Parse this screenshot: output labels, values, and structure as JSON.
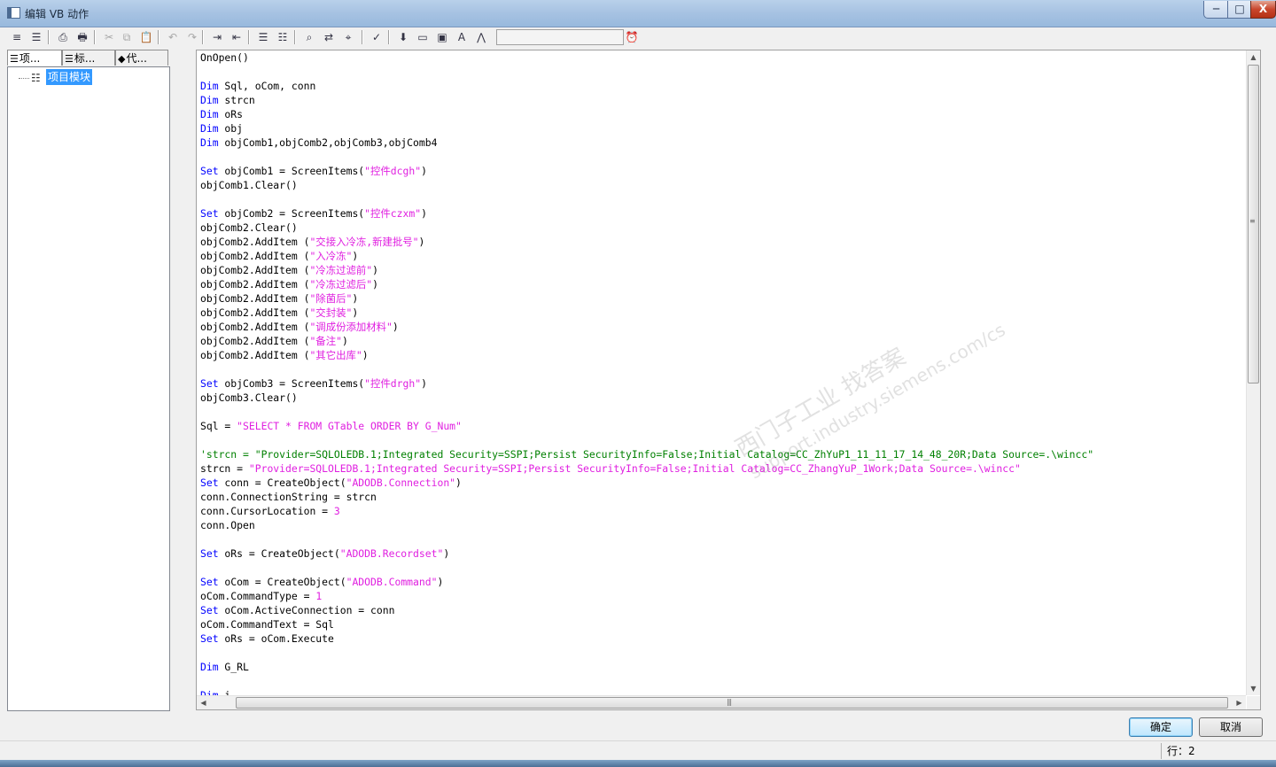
{
  "window": {
    "title": "编辑 VB 动作",
    "min_label": "─",
    "max_label": "□",
    "close_label": "X"
  },
  "toolbar": {
    "buttons": [
      {
        "name": "align-left-icon",
        "glyph": "≡"
      },
      {
        "name": "format-icon",
        "glyph": "☰"
      },
      {
        "name": "print-icon",
        "glyph": "⎙"
      },
      {
        "name": "print-preview-icon",
        "glyph": "🖶"
      },
      {
        "name": "cut-icon",
        "glyph": "✂"
      },
      {
        "name": "copy-icon",
        "glyph": "⧉"
      },
      {
        "name": "paste-icon",
        "glyph": "📋"
      },
      {
        "name": "undo-icon",
        "glyph": "↶"
      },
      {
        "name": "redo-icon",
        "glyph": "↷"
      },
      {
        "name": "indent-icon",
        "glyph": "⇥"
      },
      {
        "name": "outdent-icon",
        "glyph": "⇤"
      },
      {
        "name": "comment-icon",
        "glyph": "☰"
      },
      {
        "name": "uncomment-icon",
        "glyph": "☷"
      },
      {
        "name": "find-icon",
        "glyph": "⌕"
      },
      {
        "name": "replace-icon",
        "glyph": "⇄"
      },
      {
        "name": "goto-icon",
        "glyph": "⌖"
      },
      {
        "name": "syntax-check-icon",
        "glyph": "✓"
      },
      {
        "name": "import-icon",
        "glyph": "⬇"
      },
      {
        "name": "folder-icon",
        "glyph": "▭"
      },
      {
        "name": "new-folder-icon",
        "glyph": "▣"
      },
      {
        "name": "tag-icon",
        "glyph": "A"
      },
      {
        "name": "compass-icon",
        "glyph": "⋀"
      },
      {
        "name": "alarm-clock-icon",
        "glyph": "⏰"
      }
    ]
  },
  "left_panel": {
    "tabs": [
      {
        "label": "项...",
        "icon": "☰"
      },
      {
        "label": "标...",
        "icon": "☰"
      },
      {
        "label": "代...",
        "icon": "◆"
      }
    ],
    "tree_item": "项目模块"
  },
  "code_lines": [
    [
      {
        "t": "OnOpen()"
      }
    ],
    [],
    [
      {
        "t": "Dim",
        "c": "kw"
      },
      {
        "t": " Sql, oCom, conn"
      }
    ],
    [
      {
        "t": "Dim",
        "c": "kw"
      },
      {
        "t": " strcn"
      }
    ],
    [
      {
        "t": "Dim",
        "c": "kw"
      },
      {
        "t": " oRs"
      }
    ],
    [
      {
        "t": "Dim",
        "c": "kw"
      },
      {
        "t": " obj"
      }
    ],
    [
      {
        "t": "Dim",
        "c": "kw"
      },
      {
        "t": " objComb1,objComb2,objComb3,objComb4"
      }
    ],
    [],
    [
      {
        "t": "Set",
        "c": "kw"
      },
      {
        "t": " objComb1 = ScreenItems("
      },
      {
        "t": "\"控件dcgh\"",
        "c": "str"
      },
      {
        "t": ")"
      }
    ],
    [
      {
        "t": "objComb1.Clear()"
      }
    ],
    [],
    [
      {
        "t": "Set",
        "c": "kw"
      },
      {
        "t": " objComb2 = ScreenItems("
      },
      {
        "t": "\"控件czxm\"",
        "c": "str"
      },
      {
        "t": ")"
      }
    ],
    [
      {
        "t": "objComb2.Clear()"
      }
    ],
    [
      {
        "t": "objComb2.AddItem ("
      },
      {
        "t": "\"交接入冷冻,新建批号\"",
        "c": "str"
      },
      {
        "t": ")"
      }
    ],
    [
      {
        "t": "objComb2.AddItem ("
      },
      {
        "t": "\"入冷冻\"",
        "c": "str"
      },
      {
        "t": ")"
      }
    ],
    [
      {
        "t": "objComb2.AddItem ("
      },
      {
        "t": "\"冷冻过滤前\"",
        "c": "str"
      },
      {
        "t": ")"
      }
    ],
    [
      {
        "t": "objComb2.AddItem ("
      },
      {
        "t": "\"冷冻过滤后\"",
        "c": "str"
      },
      {
        "t": ")"
      }
    ],
    [
      {
        "t": "objComb2.AddItem ("
      },
      {
        "t": "\"除菌后\"",
        "c": "str"
      },
      {
        "t": ")"
      }
    ],
    [
      {
        "t": "objComb2.AddItem ("
      },
      {
        "t": "\"交封装\"",
        "c": "str"
      },
      {
        "t": ")"
      }
    ],
    [
      {
        "t": "objComb2.AddItem ("
      },
      {
        "t": "\"调成份添加材料\"",
        "c": "str"
      },
      {
        "t": ")"
      }
    ],
    [
      {
        "t": "objComb2.AddItem ("
      },
      {
        "t": "\"备注\"",
        "c": "str"
      },
      {
        "t": ")"
      }
    ],
    [
      {
        "t": "objComb2.AddItem ("
      },
      {
        "t": "\"其它出库\"",
        "c": "str"
      },
      {
        "t": ")"
      }
    ],
    [],
    [
      {
        "t": "Set",
        "c": "kw"
      },
      {
        "t": " objComb3 = ScreenItems("
      },
      {
        "t": "\"控件drgh\"",
        "c": "str"
      },
      {
        "t": ")"
      }
    ],
    [
      {
        "t": "objComb3.Clear()"
      }
    ],
    [],
    [
      {
        "t": "Sql = "
      },
      {
        "t": "\"SELECT * FROM GTable ORDER BY G_Num\"",
        "c": "str"
      }
    ],
    [],
    [
      {
        "t": "'strcn = \"Provider=SQLOLEDB.1;Integrated Security=SSPI;Persist SecurityInfo=False;Initial Catalog=CC_ZhYuP1_11_11_17_14_48_20R;Data Source=.\\wincc\"",
        "c": "cm"
      }
    ],
    [
      {
        "t": "strcn = "
      },
      {
        "t": "\"Provider=SQLOLEDB.1;Integrated Security=SSPI;Persist SecurityInfo=False;Initial Catalog=CC_ZhangYuP_1Work;Data Source=.\\wincc\"",
        "c": "str"
      }
    ],
    [
      {
        "t": "Set",
        "c": "kw"
      },
      {
        "t": " conn = CreateObject("
      },
      {
        "t": "\"ADODB.Connection\"",
        "c": "str"
      },
      {
        "t": ")"
      }
    ],
    [
      {
        "t": "conn.ConnectionString = strcn"
      }
    ],
    [
      {
        "t": "conn.CursorLocation = "
      },
      {
        "t": "3",
        "c": "num"
      }
    ],
    [
      {
        "t": "conn.Open"
      }
    ],
    [],
    [
      {
        "t": "Set",
        "c": "kw"
      },
      {
        "t": " oRs = CreateObject("
      },
      {
        "t": "\"ADODB.Recordset\"",
        "c": "str"
      },
      {
        "t": ")"
      }
    ],
    [],
    [
      {
        "t": "Set",
        "c": "kw"
      },
      {
        "t": " oCom = CreateObject("
      },
      {
        "t": "\"ADODB.Command\"",
        "c": "str"
      },
      {
        "t": ")"
      }
    ],
    [
      {
        "t": "oCom.CommandType = "
      },
      {
        "t": "1",
        "c": "num"
      }
    ],
    [
      {
        "t": "Set",
        "c": "kw"
      },
      {
        "t": " oCom.ActiveConnection = conn"
      }
    ],
    [
      {
        "t": "oCom.CommandText = Sql"
      }
    ],
    [
      {
        "t": "Set",
        "c": "kw"
      },
      {
        "t": " oRs = oCom.Execute"
      }
    ],
    [],
    [
      {
        "t": "Dim",
        "c": "kw"
      },
      {
        "t": " G_RL"
      }
    ],
    [],
    [
      {
        "t": "Dim",
        "c": "kw"
      },
      {
        "t": " i"
      }
    ]
  ],
  "watermark": [
    "西门子工业   找答案",
    "support.industry.siemens.com/cs"
  ],
  "buttons": {
    "ok_label": "确定",
    "cancel_label": "取消"
  },
  "status": {
    "row_text": "行：2"
  },
  "colors": {
    "keyword": "#0000ff",
    "string": "#e020e0",
    "comment": "#008000",
    "selection": "#3399ff"
  }
}
